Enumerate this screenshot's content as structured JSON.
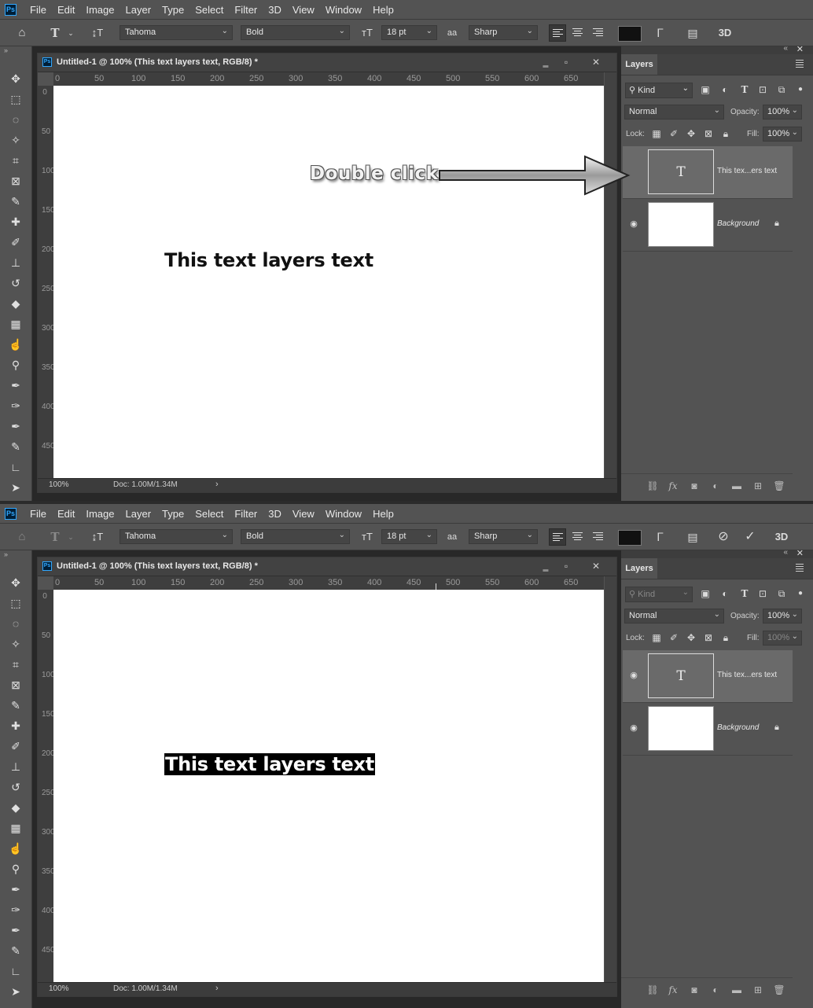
{
  "menu": [
    "File",
    "Edit",
    "Image",
    "Layer",
    "Type",
    "Select",
    "Filter",
    "3D",
    "View",
    "Window",
    "Help"
  ],
  "options": {
    "font_family": "Tahoma",
    "font_style": "Bold",
    "font_size": "18 pt",
    "antialias_label": "aa",
    "antialias": "Sharp",
    "color_swatch": "#111111",
    "three_d": "3D"
  },
  "document": {
    "title": "Untitled-1 @ 100% (This text layers text, RGB/8) *",
    "ruler_h": [
      "0",
      "50",
      "100",
      "150",
      "200",
      "250",
      "300",
      "350",
      "400",
      "450",
      "500",
      "550",
      "600",
      "650"
    ],
    "ruler_v": [
      "0",
      "50",
      "100",
      "150",
      "200",
      "250",
      "300",
      "350",
      "400",
      "450"
    ],
    "canvas_text": "This text layers text",
    "zoom": "100%",
    "doc_size": "Doc: 1.00M/1.34M"
  },
  "annotation": {
    "label": "Double click"
  },
  "layers_panel": {
    "tab": "Layers",
    "kind": "Kind",
    "blend_mode": "Normal",
    "opacity_label": "Opacity:",
    "opacity": "100%",
    "lock_label": "Lock:",
    "fill_label": "Fill:",
    "fill": "100%",
    "layers": [
      {
        "name": "This tex...ers text",
        "type": "text",
        "thumb_glyph": "T"
      },
      {
        "name": "Background",
        "type": "background"
      }
    ]
  },
  "colors": {
    "menu_bg": "#535353",
    "app_bg": "#282828",
    "canvas": "#ffffff",
    "active_layer": "#6a6a6a",
    "ps_blue": "#31a8ff"
  }
}
